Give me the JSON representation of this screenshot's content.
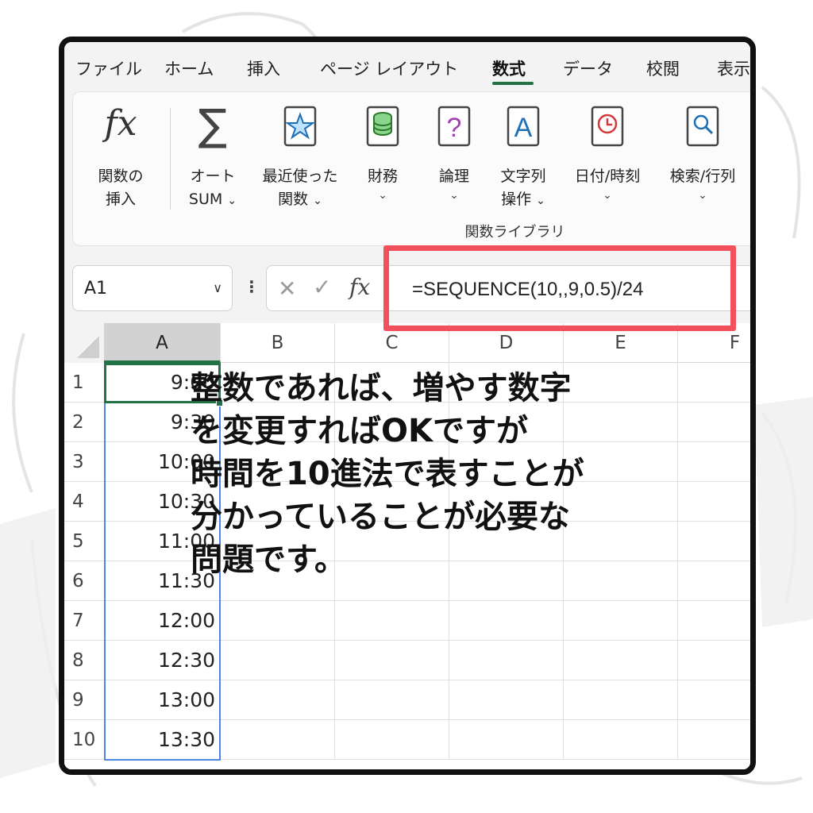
{
  "menu": {
    "tabs": [
      "ファイル",
      "ホーム",
      "挿入",
      "ページ レイアウト",
      "数式",
      "データ",
      "校閲",
      "表示"
    ],
    "active_tab": "数式"
  },
  "ribbon": {
    "buttons": [
      {
        "label": "関数の\n挿入",
        "icon": "fx-icon",
        "chevron": false
      },
      {
        "label": "オート\nSUM",
        "icon": "sigma-icon",
        "chevron": true
      },
      {
        "label": "最近使った\n関数",
        "icon": "star-icon",
        "chevron": true
      },
      {
        "label": "財務",
        "icon": "database-icon",
        "chevron": true
      },
      {
        "label": "論理",
        "icon": "question-icon",
        "chevron": true
      },
      {
        "label": "文字列\n操作",
        "icon": "letter-a-icon",
        "chevron": true
      },
      {
        "label": "日付/時刻",
        "icon": "clock-icon",
        "chevron": true
      },
      {
        "label": "検索/行列",
        "icon": "magnifier-icon",
        "chevron": true
      }
    ],
    "group_label": "関数ライブラリ",
    "chevron_glyph": "⌄"
  },
  "formula_bar": {
    "name_box": "A1",
    "fx_label": "fx",
    "formula": "=SEQUENCE(10,,9,0.5)/24"
  },
  "grid": {
    "columns": [
      "A",
      "B",
      "C",
      "D",
      "E",
      "F"
    ],
    "rows": [
      "1",
      "2",
      "3",
      "4",
      "5",
      "6",
      "7",
      "8",
      "9",
      "10"
    ],
    "column_a_values": [
      "9:00",
      "9:30",
      "10:00",
      "10:30",
      "11:00",
      "11:30",
      "12:00",
      "12:30",
      "13:00",
      "13:30"
    ],
    "active_cell": "A1"
  },
  "caption": {
    "lines": [
      "整数であれば、増やす数字",
      "を変更すればOKですが",
      "時間を10進法で表すことが",
      "分かっていることが必要な",
      "問題です。"
    ]
  },
  "colors": {
    "accent_green": "#217346",
    "highlight_red": "#f2515b",
    "spill_blue": "#4a86e8"
  }
}
